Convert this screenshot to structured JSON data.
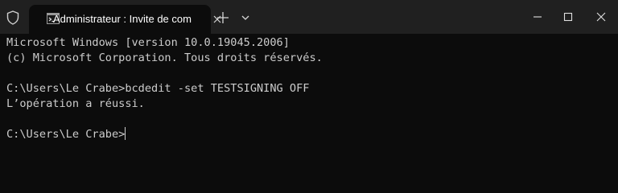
{
  "titlebar": {
    "tab_title": "Administrateur : Invite de com"
  },
  "console": {
    "lines": [
      "Microsoft Windows [version 10.0.19045.2006]",
      "(c) Microsoft Corporation. Tous droits réservés.",
      "",
      "C:\\Users\\Le Crabe>bcdedit -set TESTSIGNING OFF",
      "L’opération a réussi.",
      "",
      "C:\\Users\\Le Crabe>"
    ]
  },
  "colors": {
    "titlebar_bg": "#202020",
    "console_bg": "#0c0c0c",
    "console_fg": "#cccccc"
  },
  "icons": {
    "shield": "shield-icon",
    "terminal": "terminal-icon",
    "close": "close-icon",
    "new_tab": "plus-icon",
    "dropdown": "chevron-down-icon",
    "minimize": "minimize-icon",
    "maximize": "maximize-icon"
  }
}
